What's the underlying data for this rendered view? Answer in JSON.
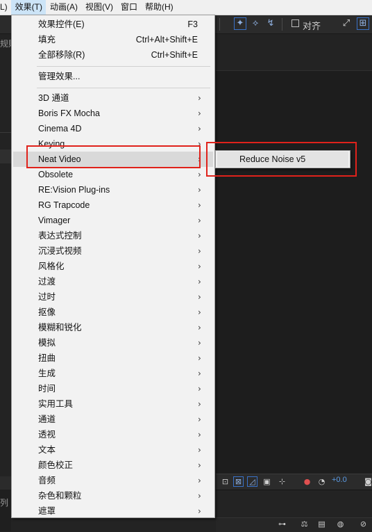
{
  "menubar": {
    "items": [
      {
        "label": "L)"
      },
      {
        "label": "效果(T)"
      },
      {
        "label": "动画(A)"
      },
      {
        "label": "视图(V)"
      },
      {
        "label": "窗口"
      },
      {
        "label": "帮助(H)"
      }
    ]
  },
  "toolbar": {
    "align_label": "对齐"
  },
  "left_panel": {
    "fragment_text": "规贴",
    "bottom_fragment_text": "列"
  },
  "bottom_bar": {
    "exposure_value": "+0.0"
  },
  "effects_menu": {
    "top_items": [
      {
        "label": "效果控件(E)",
        "shortcut": "F3"
      },
      {
        "label": "填充",
        "shortcut": "Ctrl+Alt+Shift+E"
      },
      {
        "label": "全部移除(R)",
        "shortcut": "Ctrl+Shift+E"
      }
    ],
    "manage_item": {
      "label": "管理效果..."
    },
    "categories": [
      {
        "label": "3D 通道"
      },
      {
        "label": "Boris FX Mocha"
      },
      {
        "label": "Cinema 4D"
      },
      {
        "label": "Keying"
      },
      {
        "label": "Neat Video"
      },
      {
        "label": "Obsolete"
      },
      {
        "label": "RE:Vision Plug-ins"
      },
      {
        "label": "RG Trapcode"
      },
      {
        "label": "Vimager"
      },
      {
        "label": "表达式控制"
      },
      {
        "label": "沉浸式视频"
      },
      {
        "label": "风格化"
      },
      {
        "label": "过渡"
      },
      {
        "label": "过时"
      },
      {
        "label": "抠像"
      },
      {
        "label": "模糊和锐化"
      },
      {
        "label": "模拟"
      },
      {
        "label": "扭曲"
      },
      {
        "label": "生成"
      },
      {
        "label": "时间"
      },
      {
        "label": "实用工具"
      },
      {
        "label": "通道"
      },
      {
        "label": "透视"
      },
      {
        "label": "文本"
      },
      {
        "label": "颜色校正"
      },
      {
        "label": "音频"
      },
      {
        "label": "杂色和颗粒"
      },
      {
        "label": "遮罩"
      }
    ],
    "highlighted_category": "Neat Video"
  },
  "submenu": {
    "items": [
      {
        "label": "Reduce Noise v5"
      }
    ]
  },
  "colors": {
    "highlight_box": "#e0221b",
    "menu_bg": "#f2f2f2",
    "app_bg": "#232323"
  }
}
